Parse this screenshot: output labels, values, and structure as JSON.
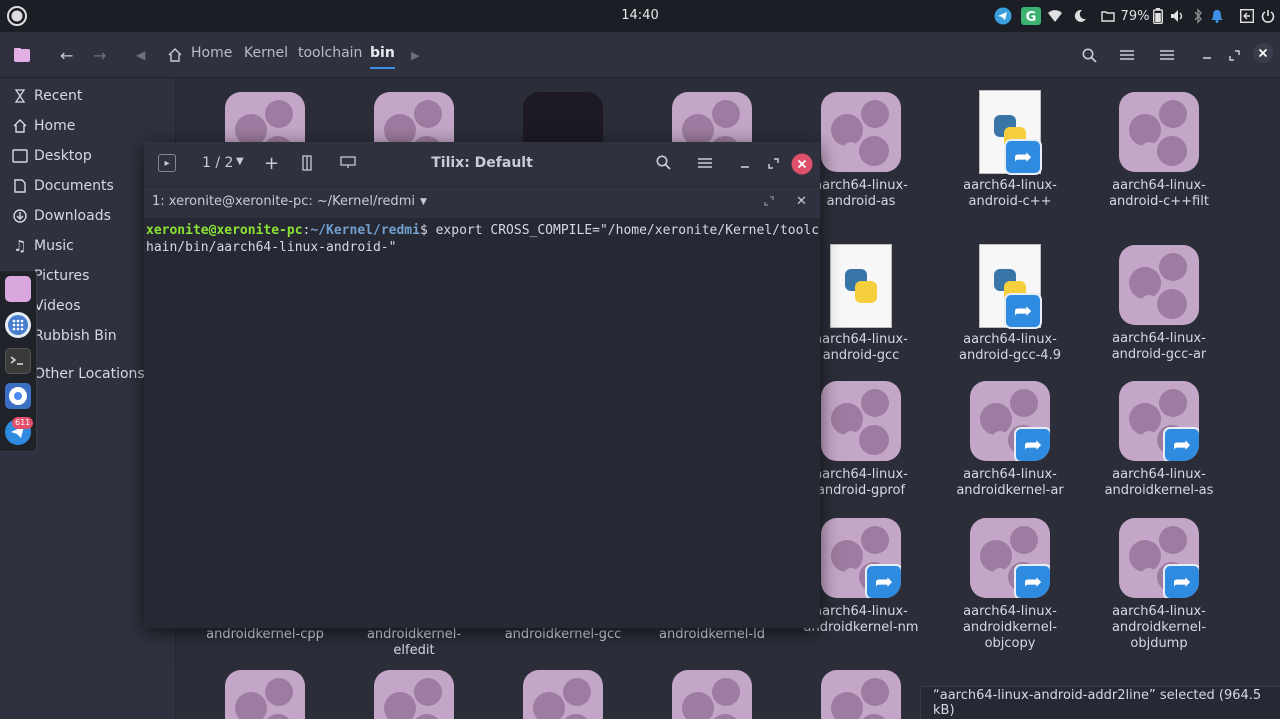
{
  "topbar": {
    "clock": "14:40",
    "badge_count": "611",
    "battery": "79%",
    "icons": [
      "activities-icon",
      "telegram-tray-icon",
      "grammarly-icon",
      "wifi-icon",
      "night-mode-icon",
      "battery-icon",
      "volume-icon",
      "bluetooth-icon",
      "notification-icon",
      "screenshot-icon",
      "power-icon"
    ]
  },
  "header": {
    "breadcrumbs": [
      "Home",
      "Kernel",
      "toolchain",
      "bin"
    ]
  },
  "sidebar": {
    "items": [
      {
        "label": "Recent",
        "icon": "clock-icon"
      },
      {
        "label": "Home",
        "icon": "home-icon"
      },
      {
        "label": "Desktop",
        "icon": "desktop-icon"
      },
      {
        "label": "Documents",
        "icon": "document-icon"
      },
      {
        "label": "Downloads",
        "icon": "download-icon"
      },
      {
        "label": "Music",
        "icon": "music-icon"
      },
      {
        "label": "Pictures",
        "icon": "picture-icon"
      },
      {
        "label": "Videos",
        "icon": "video-icon"
      },
      {
        "label": "Rubbish Bin",
        "icon": "trash-icon"
      },
      {
        "label": "Other Locations",
        "icon": "plus-icon"
      }
    ]
  },
  "dock": {
    "badge": "611"
  },
  "files": [
    {
      "name": "aarch64-linux-android-as",
      "line1": "aarch64-linux-",
      "line2": "android-as"
    },
    {
      "name": "aarch64-linux-android-c++",
      "line1": "aarch64-linux-",
      "line2": "android-c++"
    },
    {
      "name": "aarch64-linux-android-c++filt",
      "line1": "aarch64-linux-",
      "line2": "android-c++filt"
    },
    {
      "name": "aarch64-linux-android-gcc",
      "line1": "aarch64-linux-",
      "line2": "android-gcc"
    },
    {
      "name": "aarch64-linux-android-gcc-4.9",
      "line1": "aarch64-linux-",
      "line2": "android-gcc-4.9"
    },
    {
      "name": "aarch64-linux-android-gcc-ar",
      "line1": "aarch64-linux-",
      "line2": "android-gcc-ar"
    },
    {
      "name": "aarch64-linux-android-gprof",
      "line1": "aarch64-linux-",
      "line2": "android-gprof"
    },
    {
      "name": "aarch64-linux-androidkernel-ar",
      "line1": "aarch64-linux-",
      "line2": "androidkernel-ar"
    },
    {
      "name": "aarch64-linux-androidkernel-as",
      "line1": "aarch64-linux-",
      "line2": "androidkernel-as"
    },
    {
      "name": "aarch64-linux-androidkernel-nm",
      "line1": "aarch64-linux-",
      "line2": "androidkernel-nm"
    },
    {
      "name": "aarch64-linux-androidkernel-objcopy",
      "line1": "aarch64-linux-",
      "line2": "androidkernel-",
      "line3": "objcopy"
    },
    {
      "name": "aarch64-linux-androidkernel-objdump",
      "line1": "aarch64-linux-",
      "line2": "androidkernel-",
      "line3": "objdump"
    }
  ],
  "hidden_labels": [
    {
      "line1": "androidkernel-cpp"
    },
    {
      "line1": "androidkernel-",
      "line2": "elfedit"
    },
    {
      "line1": "androidkernel-gcc"
    },
    {
      "line1": "androidkernel-ld"
    }
  ],
  "tilix": {
    "session_counter": "1 / 2",
    "title": "Tilix: Default",
    "tab_label": "1: xeronite@xeronite-pc: ~/Kernel/redmi",
    "prompt_user": "xeronite@xeronite-pc",
    "prompt_sep": ":",
    "prompt_path": "~/Kernel/redmi",
    "prompt_dollar": "$ ",
    "command": "export CROSS_COMPILE=\"/home/xeronite/Kernel/toolchain/bin/aarch64-linux-android-\""
  },
  "status": {
    "text": "“aarch64-linux-android-addr2line” selected  (964.5 kB)"
  },
  "colors": {
    "accent": "#2f8be0",
    "close": "#e0506b",
    "prompt_user": "#8ae234",
    "prompt_path": "#729fcf"
  }
}
